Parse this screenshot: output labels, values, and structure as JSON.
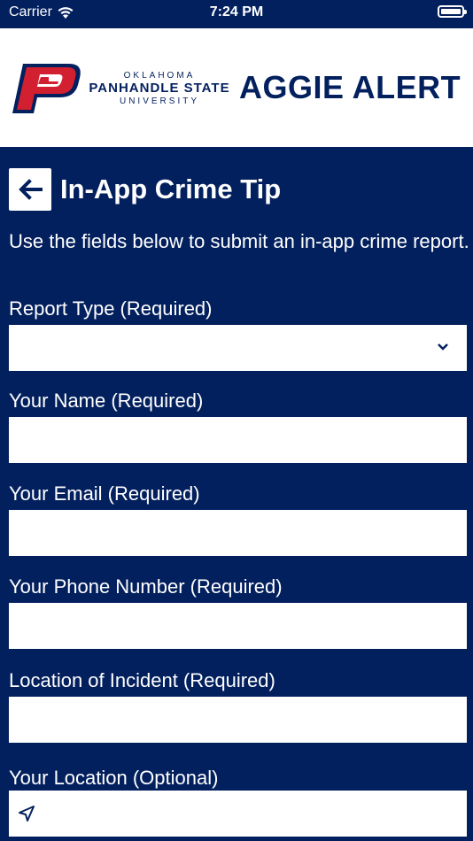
{
  "status_bar": {
    "carrier": "Carrier",
    "time": "7:24 PM"
  },
  "header": {
    "university_line1": "OKLAHOMA",
    "university_line2": "PANHANDLE STATE",
    "university_line3": "UNIVERSITY",
    "app_name": "AGGIE ALERT",
    "brand_colors": {
      "navy": "#03205e",
      "red": "#d22030"
    }
  },
  "page": {
    "title": "In-App Crime Tip",
    "intro": "Use the fields below to submit an in-app crime report."
  },
  "form": {
    "report_type_label": "Report Type (Required)",
    "report_type_value": "",
    "name_label": "Your Name (Required)",
    "name_value": "",
    "email_label": "Your Email (Required)",
    "email_value": "",
    "phone_label": "Your Phone Number (Required)",
    "phone_value": "",
    "incident_location_label": "Location of Incident (Required)",
    "incident_location_value": "",
    "your_location_label": "Your Location (Optional)",
    "your_location_value": ""
  },
  "icons": {
    "back": "arrow-left-icon",
    "dropdown": "chevron-down-icon",
    "location": "location-arrow-icon"
  }
}
